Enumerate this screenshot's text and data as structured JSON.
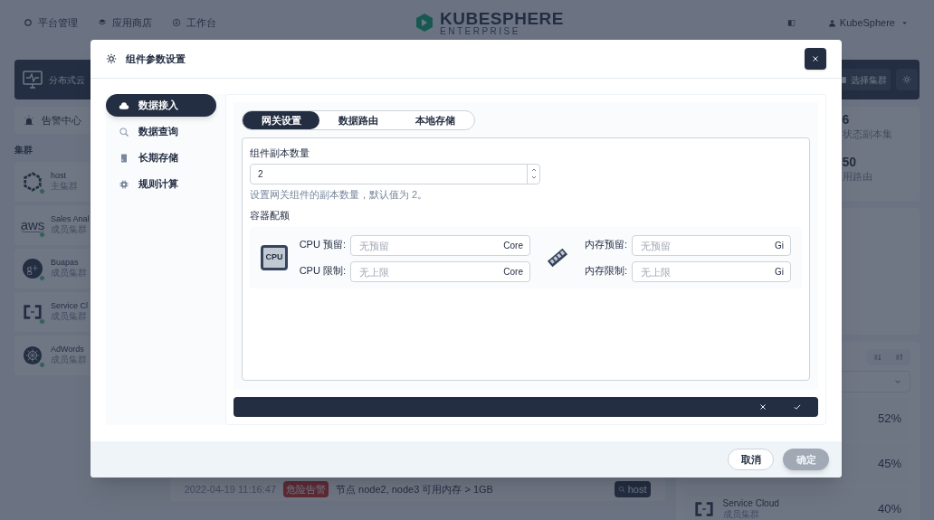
{
  "top_nav": {
    "items": [
      {
        "label": "平台管理",
        "kind": "ring"
      },
      {
        "label": "应用商店",
        "kind": "layers"
      },
      {
        "label": "工作台",
        "kind": "download"
      }
    ],
    "logo": {
      "title": "KUBESPHERE",
      "subtitle": "ENTERPRISE"
    },
    "user": "KubeSphere"
  },
  "background": {
    "banner": {
      "title": "分布式云",
      "select_button": "选择集群"
    },
    "alert_center": "告警中心",
    "clusters_heading": "集群",
    "clusters": [
      {
        "name": "host",
        "role": "主集群",
        "kind": "hexagon"
      },
      {
        "name": "Sales Anal",
        "role": "成员集群",
        "kind": "text",
        "logo_text": "aws"
      },
      {
        "name": "Buapas",
        "role": "成员集群",
        "kind": "badge",
        "logo_text": "g+"
      },
      {
        "name": "Service Cl",
        "role": "成员集群",
        "kind": "bracket"
      },
      {
        "name": "AdWords",
        "role": "成员集群",
        "kind": "wheel"
      }
    ],
    "stats": [
      {
        "value": "6",
        "label": "状态副本集"
      },
      {
        "value": "50",
        "label": "用路由"
      }
    ],
    "usage": [
      {
        "value": "52%"
      },
      {
        "value": "45%"
      },
      {
        "name": "Service Cloud",
        "role": "成员集群",
        "value": "40%"
      }
    ],
    "alerts": [
      {
        "time": "2022-04-19 11:16:47",
        "severity": "危险告警",
        "message": "节点 node2, node3 可用内存 > 1GB",
        "cluster": "host"
      }
    ]
  },
  "dialog": {
    "title": "组件参数设置",
    "nav": [
      {
        "label": "数据接入",
        "kind": "upload",
        "selected": true
      },
      {
        "label": "数据查询",
        "kind": "search",
        "selected": false
      },
      {
        "label": "长期存储",
        "kind": "storage",
        "selected": false
      },
      {
        "label": "规则计算",
        "kind": "chip",
        "selected": false
      }
    ],
    "tabs": [
      {
        "label": "网关设置",
        "selected": true
      },
      {
        "label": "数据路由",
        "selected": false
      },
      {
        "label": "本地存储",
        "selected": false
      }
    ],
    "replicas": {
      "label": "组件副本数量",
      "value": "2",
      "help": "设置网关组件的副本数量，默认值为 2。"
    },
    "quota": {
      "title": "容器配额",
      "cpu_icon_label": "CPU",
      "cpu": [
        {
          "label": "CPU 预留:",
          "placeholder": "无预留",
          "unit": "Core"
        },
        {
          "label": "CPU 限制:",
          "placeholder": "无上限",
          "unit": "Core"
        }
      ],
      "memory": [
        {
          "label": "内存预留:",
          "placeholder": "无预留",
          "unit": "Gi"
        },
        {
          "label": "内存限制:",
          "placeholder": "无上限",
          "unit": "Gi"
        }
      ]
    },
    "footer": {
      "cancel": "取消",
      "confirm": "确定",
      "confirm_disabled": true
    }
  }
}
